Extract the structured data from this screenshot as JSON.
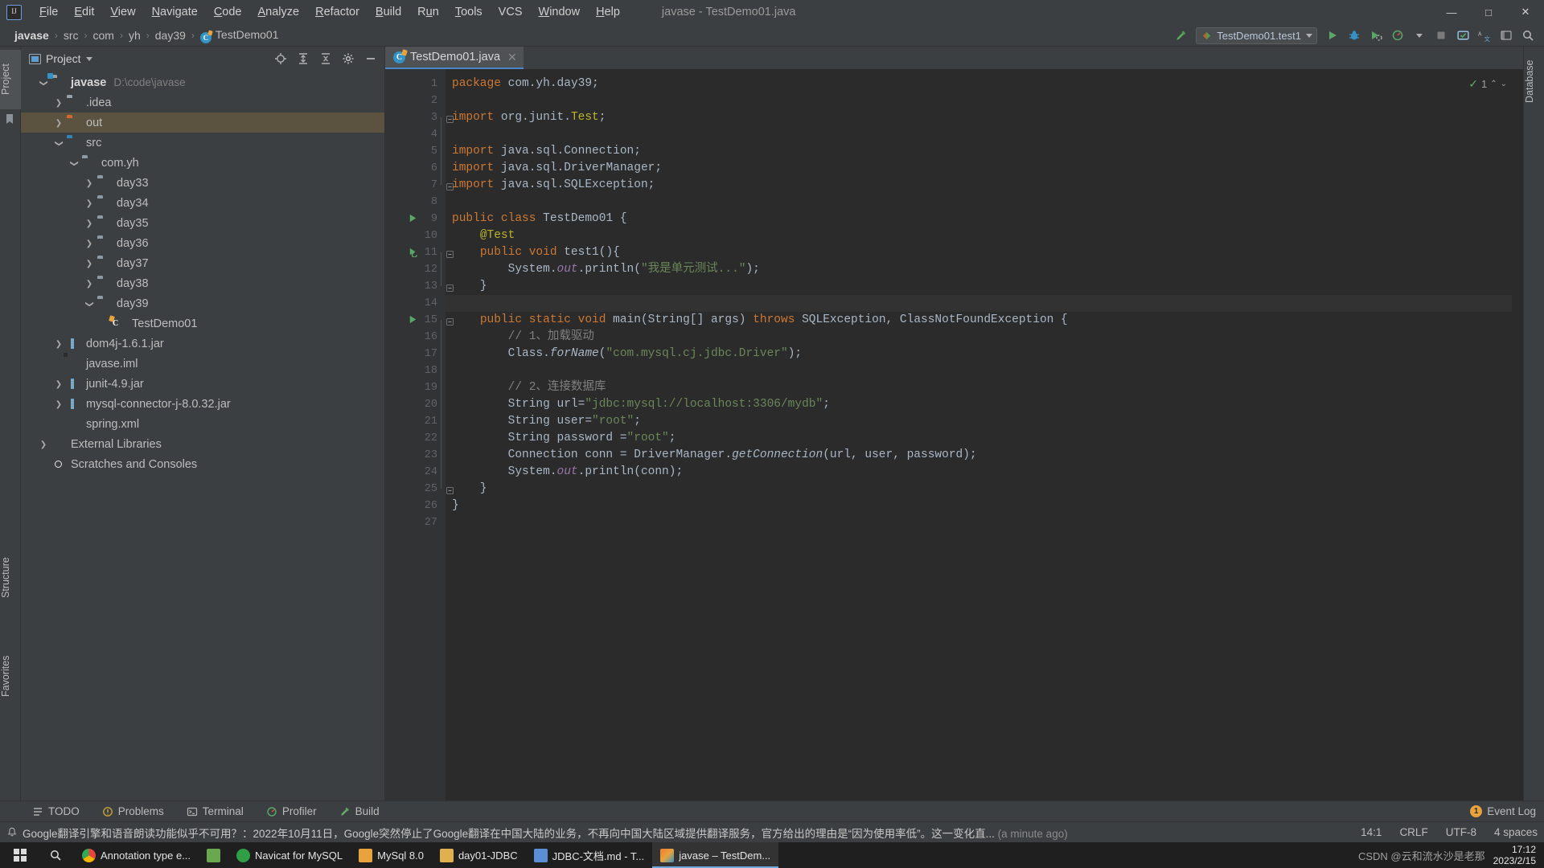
{
  "menubar": {
    "app_icon": "intellij-logo",
    "items": [
      {
        "label": "File",
        "mnemonic": "F"
      },
      {
        "label": "Edit",
        "mnemonic": "E"
      },
      {
        "label": "View",
        "mnemonic": "V"
      },
      {
        "label": "Navigate",
        "mnemonic": "N"
      },
      {
        "label": "Code",
        "mnemonic": "C"
      },
      {
        "label": "Analyze",
        "mnemonic": "A"
      },
      {
        "label": "Refactor",
        "mnemonic": "R"
      },
      {
        "label": "Build",
        "mnemonic": "B"
      },
      {
        "label": "Run",
        "mnemonic": "u"
      },
      {
        "label": "Tools",
        "mnemonic": "T"
      },
      {
        "label": "VCS",
        "mnemonic": ""
      },
      {
        "label": "Window",
        "mnemonic": "W"
      },
      {
        "label": "Help",
        "mnemonic": "H"
      }
    ],
    "window_title": "javase - TestDemo01.java",
    "window_controls": {
      "minimize": "—",
      "maximize": "□",
      "close": "✕"
    }
  },
  "navbar": {
    "breadcrumbs": [
      {
        "label": "javase",
        "bold": true
      },
      {
        "label": "src",
        "bold": false
      },
      {
        "label": "com",
        "bold": false
      },
      {
        "label": "yh",
        "bold": false
      },
      {
        "label": "day39",
        "bold": false
      },
      {
        "label": "TestDemo01",
        "bold": false,
        "icon": "java-class-icon"
      }
    ],
    "separator": "›",
    "run_config": "TestDemo01.test1",
    "icons": [
      {
        "name": "build-hammer-icon"
      },
      {
        "name": "run-icon"
      },
      {
        "name": "debug-icon"
      },
      {
        "name": "run-with-coverage-icon"
      },
      {
        "name": "profiler-icon"
      },
      {
        "name": "more-dropdown-icon"
      },
      {
        "name": "stop-icon"
      },
      {
        "name": "updates-icon"
      },
      {
        "name": "translate-icon"
      },
      {
        "name": "layout-icon"
      },
      {
        "name": "search-everywhere-icon"
      }
    ]
  },
  "left_strip": [
    {
      "label": "Project",
      "selected": true,
      "icon": "project-icon"
    },
    {
      "label": "Structure",
      "selected": false,
      "icon": "structure-icon"
    },
    {
      "label": "Favorites",
      "selected": false,
      "icon": "favorites-icon"
    }
  ],
  "right_strip": [
    {
      "label": "Database",
      "selected": false,
      "icon": "database-icon"
    }
  ],
  "project_panel": {
    "title": "Project",
    "header_icons": [
      {
        "name": "select-opened-file-icon"
      },
      {
        "name": "expand-all-icon"
      },
      {
        "name": "collapse-all-icon"
      },
      {
        "name": "settings-gear-icon"
      },
      {
        "name": "hide-panel-icon"
      }
    ],
    "tree": [
      {
        "label": "javase",
        "path": "D:\\code\\javase",
        "indent": 0,
        "arrow": "down",
        "icon": "module-folder",
        "bold": true,
        "selected": false
      },
      {
        "label": ".idea",
        "path": "",
        "indent": 1,
        "arrow": "right",
        "icon": "folder-grey",
        "bold": false,
        "selected": false
      },
      {
        "label": "out",
        "path": "",
        "indent": 1,
        "arrow": "right",
        "icon": "folder-orange",
        "bold": false,
        "selected": true
      },
      {
        "label": "src",
        "path": "",
        "indent": 1,
        "arrow": "down",
        "icon": "folder-blue",
        "bold": false,
        "selected": false
      },
      {
        "label": "com.yh",
        "path": "",
        "indent": 2,
        "arrow": "down",
        "icon": "package",
        "bold": false,
        "selected": false
      },
      {
        "label": "day33",
        "path": "",
        "indent": 3,
        "arrow": "right",
        "icon": "package",
        "bold": false,
        "selected": false
      },
      {
        "label": "day34",
        "path": "",
        "indent": 3,
        "arrow": "right",
        "icon": "package",
        "bold": false,
        "selected": false
      },
      {
        "label": "day35",
        "path": "",
        "indent": 3,
        "arrow": "right",
        "icon": "package",
        "bold": false,
        "selected": false
      },
      {
        "label": "day36",
        "path": "",
        "indent": 3,
        "arrow": "right",
        "icon": "package",
        "bold": false,
        "selected": false
      },
      {
        "label": "day37",
        "path": "",
        "indent": 3,
        "arrow": "right",
        "icon": "package",
        "bold": false,
        "selected": false
      },
      {
        "label": "day38",
        "path": "",
        "indent": 3,
        "arrow": "right",
        "icon": "package",
        "bold": false,
        "selected": false
      },
      {
        "label": "day39",
        "path": "",
        "indent": 3,
        "arrow": "down",
        "icon": "package",
        "bold": false,
        "selected": false
      },
      {
        "label": "TestDemo01",
        "path": "",
        "indent": 4,
        "arrow": "none",
        "icon": "java-class",
        "bold": false,
        "selected": false
      },
      {
        "label": "dom4j-1.6.1.jar",
        "path": "",
        "indent": 1,
        "arrow": "right",
        "icon": "jar",
        "bold": false,
        "selected": false
      },
      {
        "label": "javase.iml",
        "path": "",
        "indent": 1,
        "arrow": "none",
        "icon": "iml",
        "bold": false,
        "selected": false
      },
      {
        "label": "junit-4.9.jar",
        "path": "",
        "indent": 1,
        "arrow": "right",
        "icon": "jar",
        "bold": false,
        "selected": false
      },
      {
        "label": "mysql-connector-j-8.0.32.jar",
        "path": "",
        "indent": 1,
        "arrow": "right",
        "icon": "jar",
        "bold": false,
        "selected": false
      },
      {
        "label": "spring.xml",
        "path": "",
        "indent": 1,
        "arrow": "none",
        "icon": "xml",
        "bold": false,
        "selected": false
      },
      {
        "label": "External Libraries",
        "path": "",
        "indent": 0,
        "arrow": "right",
        "icon": "libraries",
        "bold": false,
        "selected": false
      },
      {
        "label": "Scratches and Consoles",
        "path": "",
        "indent": 0,
        "arrow": "none",
        "icon": "scratches",
        "bold": false,
        "selected": false
      }
    ]
  },
  "editor": {
    "tab": {
      "label": "TestDemo01.java",
      "icon": "java-class-icon",
      "close": "✕"
    },
    "inspection": {
      "count": "1",
      "check": "✓",
      "up": "⌃",
      "down": "⌄"
    },
    "current_line": 14,
    "total_lines": 27,
    "lines": [
      {
        "n": 1,
        "tokens": [
          {
            "t": "package ",
            "c": "kw"
          },
          {
            "t": "com.yh.day39;",
            "c": ""
          }
        ]
      },
      {
        "n": 2,
        "tokens": []
      },
      {
        "n": 3,
        "fold": "minus",
        "tokens": [
          {
            "t": "import ",
            "c": "kw"
          },
          {
            "t": "org.junit.",
            "c": ""
          },
          {
            "t": "Test",
            "c": "ann"
          },
          {
            "t": ";",
            "c": ""
          }
        ]
      },
      {
        "n": 4,
        "tokens": []
      },
      {
        "n": 5,
        "tokens": [
          {
            "t": "import ",
            "c": "kw"
          },
          {
            "t": "java.sql.Connection;",
            "c": ""
          }
        ]
      },
      {
        "n": 6,
        "tokens": [
          {
            "t": "import ",
            "c": "kw"
          },
          {
            "t": "java.sql.DriverManager;",
            "c": ""
          }
        ]
      },
      {
        "n": 7,
        "fold": "minus",
        "tokens": [
          {
            "t": "import ",
            "c": "kw"
          },
          {
            "t": "java.sql.SQLException;",
            "c": ""
          }
        ]
      },
      {
        "n": 8,
        "tokens": []
      },
      {
        "n": 9,
        "mark": "run",
        "tokens": [
          {
            "t": "public class ",
            "c": "kw"
          },
          {
            "t": "TestDemo01 {",
            "c": ""
          }
        ]
      },
      {
        "n": 10,
        "tokens": [
          {
            "t": "    ",
            "c": ""
          },
          {
            "t": "@Test",
            "c": "ann"
          }
        ]
      },
      {
        "n": 11,
        "mark": "test",
        "fold": "minus",
        "tokens": [
          {
            "t": "    ",
            "c": ""
          },
          {
            "t": "public void ",
            "c": "kw"
          },
          {
            "t": "test1",
            "c": ""
          },
          {
            "t": "(){",
            "c": ""
          }
        ]
      },
      {
        "n": 12,
        "tokens": [
          {
            "t": "        System.",
            "c": ""
          },
          {
            "t": "out",
            "c": "fld"
          },
          {
            "t": ".println(",
            "c": ""
          },
          {
            "t": "\"我是单元测试...\"",
            "c": "str"
          },
          {
            "t": ");",
            "c": ""
          }
        ]
      },
      {
        "n": 13,
        "fold": "minus",
        "tokens": [
          {
            "t": "    }",
            "c": ""
          }
        ]
      },
      {
        "n": 14,
        "tokens": []
      },
      {
        "n": 15,
        "mark": "run",
        "fold": "minus",
        "tokens": [
          {
            "t": "    ",
            "c": ""
          },
          {
            "t": "public static void ",
            "c": "kw"
          },
          {
            "t": "main",
            "c": ""
          },
          {
            "t": "(String[] args) ",
            "c": ""
          },
          {
            "t": "throws ",
            "c": "kw"
          },
          {
            "t": "SQLException, ClassNotFoundException {",
            "c": ""
          }
        ]
      },
      {
        "n": 16,
        "tokens": [
          {
            "t": "        // 1、加载驱动",
            "c": "cmt"
          }
        ]
      },
      {
        "n": 17,
        "tokens": [
          {
            "t": "        Class.",
            "c": ""
          },
          {
            "t": "forName",
            "c": "stat"
          },
          {
            "t": "(",
            "c": ""
          },
          {
            "t": "\"com.mysql.cj.jdbc.Driver\"",
            "c": "str"
          },
          {
            "t": ");",
            "c": ""
          }
        ]
      },
      {
        "n": 18,
        "tokens": []
      },
      {
        "n": 19,
        "tokens": [
          {
            "t": "        // 2、连接数据库",
            "c": "cmt"
          }
        ]
      },
      {
        "n": 20,
        "tokens": [
          {
            "t": "        String url=",
            "c": ""
          },
          {
            "t": "\"jdbc:mysql://localhost:3306/mydb\"",
            "c": "str"
          },
          {
            "t": ";",
            "c": ""
          }
        ]
      },
      {
        "n": 21,
        "tokens": [
          {
            "t": "        String user=",
            "c": ""
          },
          {
            "t": "\"root\"",
            "c": "str"
          },
          {
            "t": ";",
            "c": ""
          }
        ]
      },
      {
        "n": 22,
        "tokens": [
          {
            "t": "        String password =",
            "c": ""
          },
          {
            "t": "\"root\"",
            "c": "str"
          },
          {
            "t": ";",
            "c": ""
          }
        ]
      },
      {
        "n": 23,
        "tokens": [
          {
            "t": "        Connection conn = DriverManager.",
            "c": ""
          },
          {
            "t": "getConnection",
            "c": "stat"
          },
          {
            "t": "(url, user, password);",
            "c": ""
          }
        ]
      },
      {
        "n": 24,
        "tokens": [
          {
            "t": "        System.",
            "c": ""
          },
          {
            "t": "out",
            "c": "fld"
          },
          {
            "t": ".println(conn);",
            "c": ""
          }
        ]
      },
      {
        "n": 25,
        "fold": "minus",
        "tokens": [
          {
            "t": "    }",
            "c": ""
          }
        ]
      },
      {
        "n": 26,
        "tokens": [
          {
            "t": "}",
            "c": ""
          }
        ]
      },
      {
        "n": 27,
        "tokens": []
      }
    ]
  },
  "bottom_toolbar": {
    "buttons": [
      {
        "label": "TODO",
        "icon": "todo-icon"
      },
      {
        "label": "Problems",
        "icon": "problems-icon"
      },
      {
        "label": "Terminal",
        "icon": "terminal-icon"
      },
      {
        "label": "Profiler",
        "icon": "profiler-icon"
      },
      {
        "label": "Build",
        "icon": "build-icon"
      }
    ],
    "event_log": {
      "label": "Event Log",
      "badge": "1"
    }
  },
  "statusbar": {
    "message": "Google翻译引擎和语音朗读功能似乎不可用？：2022年10月11日，Google突然停止了Google翻译在中国大陆的业务，不再向中国大陆区域提供翻译服务，官方给出的理由是“因为使用率低”。这一变化直... ",
    "message_time": "(a minute ago)",
    "caret": "14:1",
    "line_separator": "CRLF",
    "encoding": "UTF-8",
    "indent": "4 spaces",
    "notification_icon": "bell-icon"
  },
  "taskbar": {
    "start_icon": "windows-start-icon",
    "search_icon": "search-icon",
    "apps": [
      {
        "label": "Annotation type e...",
        "icon": "chrome-icon",
        "color": "#e8a33d",
        "active": false
      },
      {
        "label": "",
        "icon": "app-icon",
        "color": "#6aa84f",
        "active": false
      },
      {
        "label": "Navicat for MySQL",
        "icon": "navicat-icon",
        "color": "#2f9e44",
        "active": false
      },
      {
        "label": "MySql 8.0",
        "icon": "notepad-icon",
        "color": "#e8a33d",
        "active": false
      },
      {
        "label": "day01-JDBC",
        "icon": "folder-icon",
        "color": "#e0b050",
        "active": false
      },
      {
        "label": "JDBC-文档.md - T...",
        "icon": "typora-icon",
        "color": "#5a8fd6",
        "active": false
      },
      {
        "label": "javase – TestDem...",
        "icon": "intellij-icon",
        "color": "#f07c2e",
        "active": true
      }
    ],
    "watermark": "CSDN @云和流水沙是老那",
    "clock_time": "17:12",
    "clock_date": "2023/2/15"
  }
}
